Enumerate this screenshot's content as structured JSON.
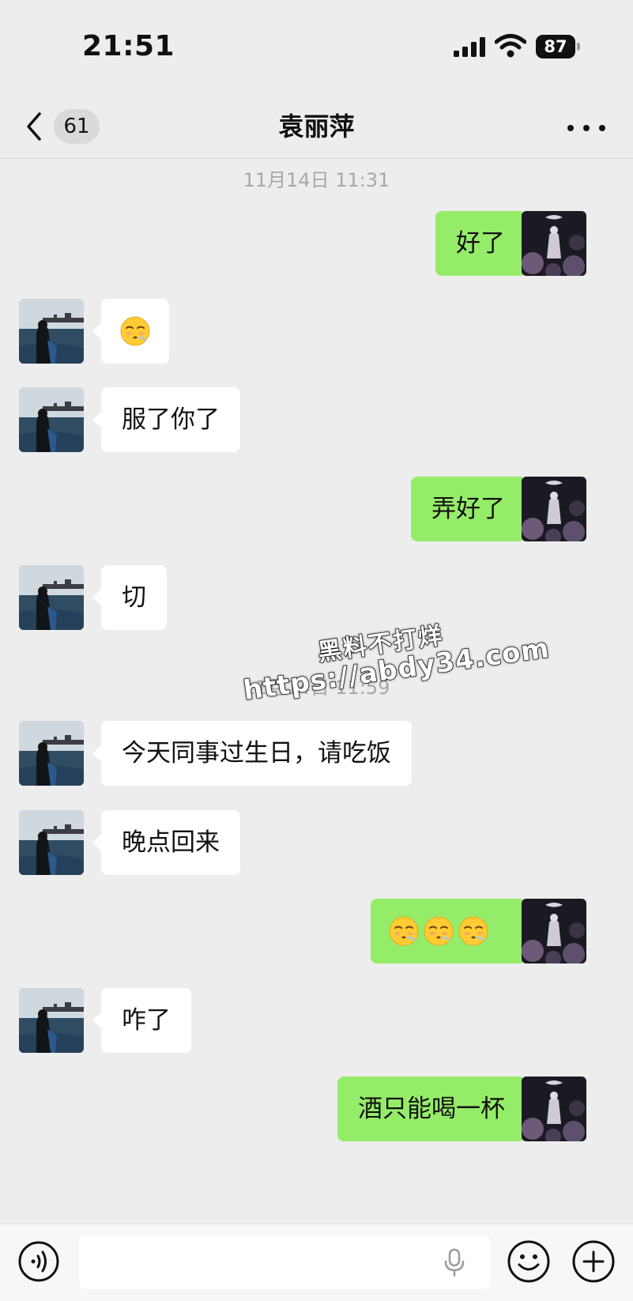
{
  "status_bar": {
    "time": "21:51",
    "battery": "87"
  },
  "header": {
    "back_count": "61",
    "title": "袁丽萍"
  },
  "timestamps": [
    "11月14日 11:31",
    "11月14日 11:59"
  ],
  "messages": [
    {
      "side": "out",
      "text": "好了"
    },
    {
      "side": "in",
      "emoji": [
        "face-exhaling-emoji"
      ]
    },
    {
      "side": "in",
      "text": "服了你了"
    },
    {
      "side": "out",
      "text": "弄好了"
    },
    {
      "side": "in",
      "text": "切"
    },
    {
      "side": "in",
      "text": "今天同事过生日，请吃饭"
    },
    {
      "side": "in",
      "text": "晚点回来"
    },
    {
      "side": "out",
      "emoji": [
        "face-exhaling-emoji",
        "face-exhaling-emoji",
        "face-exhaling-emoji"
      ]
    },
    {
      "side": "in",
      "text": "咋了"
    },
    {
      "side": "out",
      "text": "酒只能喝一杯"
    }
  ],
  "watermark": {
    "line1": "黑料不打烊",
    "line2": "https://abdy34.com"
  },
  "input_bar": {
    "placeholder": ""
  },
  "colors": {
    "background": "#ededed",
    "outgoing_bubble": "#95ec69",
    "incoming_bubble": "#ffffff",
    "timestamp": "#a7a7a7"
  }
}
